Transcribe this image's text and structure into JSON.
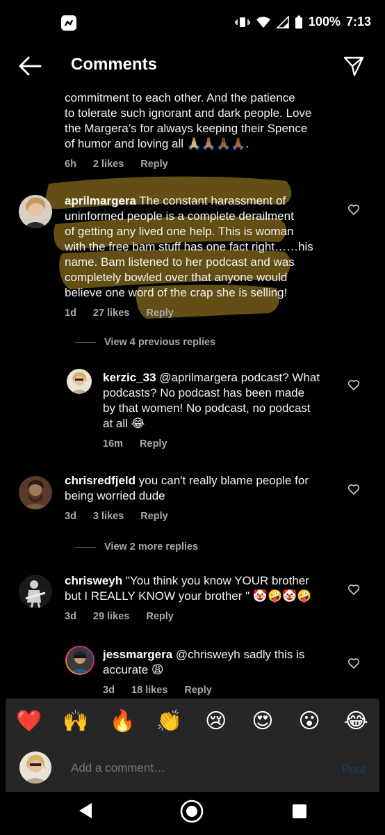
{
  "status_bar": {
    "battery": "100%",
    "time": "7:13"
  },
  "header": {
    "title": "Comments"
  },
  "comments": [
    {
      "lines": [
        "commitment to each other. And the patience",
        "to tolerate such ignorant and dark people. Love",
        "the Margera’s for always keeping their Spence",
        "of humor and loving all 🙏🏼🙏🏽🙏🏾🙏🏾."
      ],
      "time": "6h",
      "likes": "2 likes",
      "reply": "Reply"
    },
    {
      "username": "aprilmargera",
      "lines": [
        " The constant harassment of",
        "uninformed people is a complete derailment",
        "of getting any lived one help. This is woman",
        "with the free bam stuff has one fact right……his",
        "name. Bam listened to her podcast and was",
        "completely bowled over that anyone would",
        "believe one word of the crap she is selling!"
      ],
      "time": "1d",
      "likes": "27 likes",
      "reply": "Reply",
      "view_replies": "View 4 previous replies"
    },
    {
      "username": "kerzic_33",
      "lines": [
        " @aprilmargera podcast? What",
        "podcasts? No podcast has been made",
        "by that women! No podcast, no podcast",
        "at all 😂"
      ],
      "time": "16m",
      "likes": "",
      "reply": "Reply"
    },
    {
      "username": "chrisredfjeld",
      "lines": [
        " you can't really blame people for",
        "being worried dude"
      ],
      "time": "3d",
      "likes": "3 likes",
      "reply": "Reply",
      "view_replies": "View 2 more replies"
    },
    {
      "username": "chrisweyh",
      "lines": [
        " \"You think you know YOUR brother",
        "but I REALLY KNOW your brother \" 🤡🤪🤡🤪"
      ],
      "time": "3d",
      "likes": "29 likes",
      "reply": "Reply"
    },
    {
      "username": "jessmargera",
      "lines": [
        " @chrisweyh sadly this is",
        "accurate 😩"
      ],
      "time": "3d",
      "likes": "18 likes",
      "reply": "Reply"
    }
  ],
  "emoji_bar": [
    "❤️",
    "🙌",
    "🔥",
    "👏",
    "😢",
    "😍",
    "😮",
    "😂"
  ],
  "comment_input": {
    "placeholder": "Add a comment…",
    "post": "Post"
  },
  "colors": {
    "highlight": "#8a6d1e",
    "post_disabled": "#1b3f6b",
    "meta": "#a8a8a8"
  }
}
